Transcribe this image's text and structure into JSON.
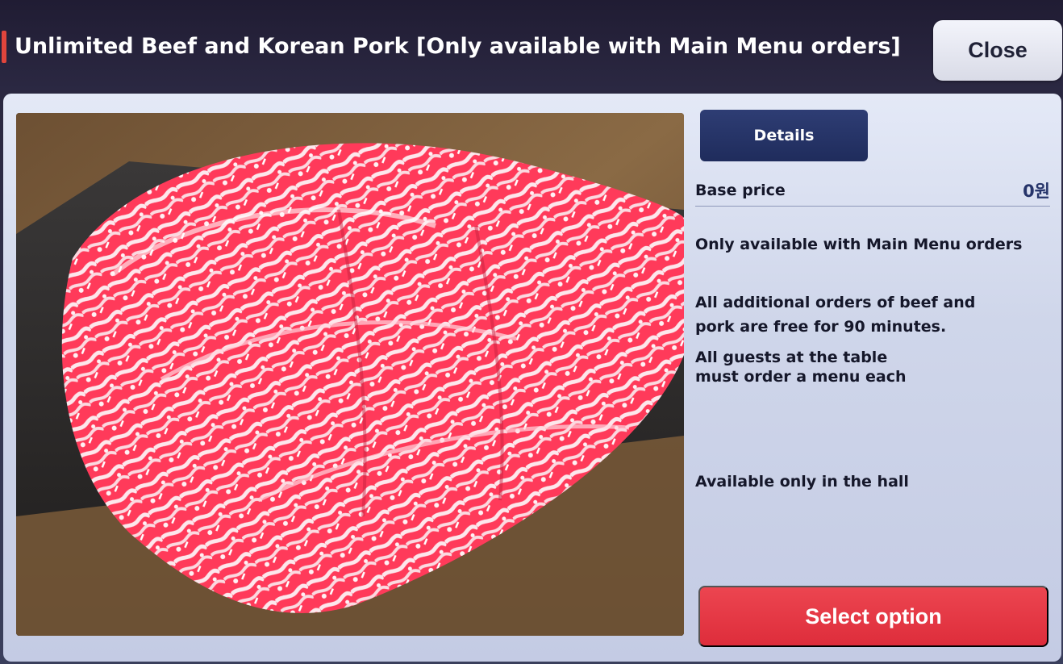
{
  "header": {
    "title": "Unlimited Beef and Korean Pork [Only available with Main Menu orders]",
    "close_label": "Close"
  },
  "product": {
    "image_icon": "marbled-beef-photo"
  },
  "details": {
    "tab_label": "Details",
    "base_price_label": "Base price",
    "base_price_value": "0원",
    "line1": "Only available with Main Menu orders",
    "line2a": "All additional orders of beef and",
    "line2b": "pork are free for 90 minutes.",
    "line3a": "All guests at the table",
    "line3b": "must order a menu each",
    "line4": "Available only in the hall"
  },
  "actions": {
    "select_label": "Select option"
  },
  "colors": {
    "accent_red": "#e0453c",
    "select_button": "#e43846",
    "details_tab": "#25336a",
    "header_bg": "#231f38"
  }
}
